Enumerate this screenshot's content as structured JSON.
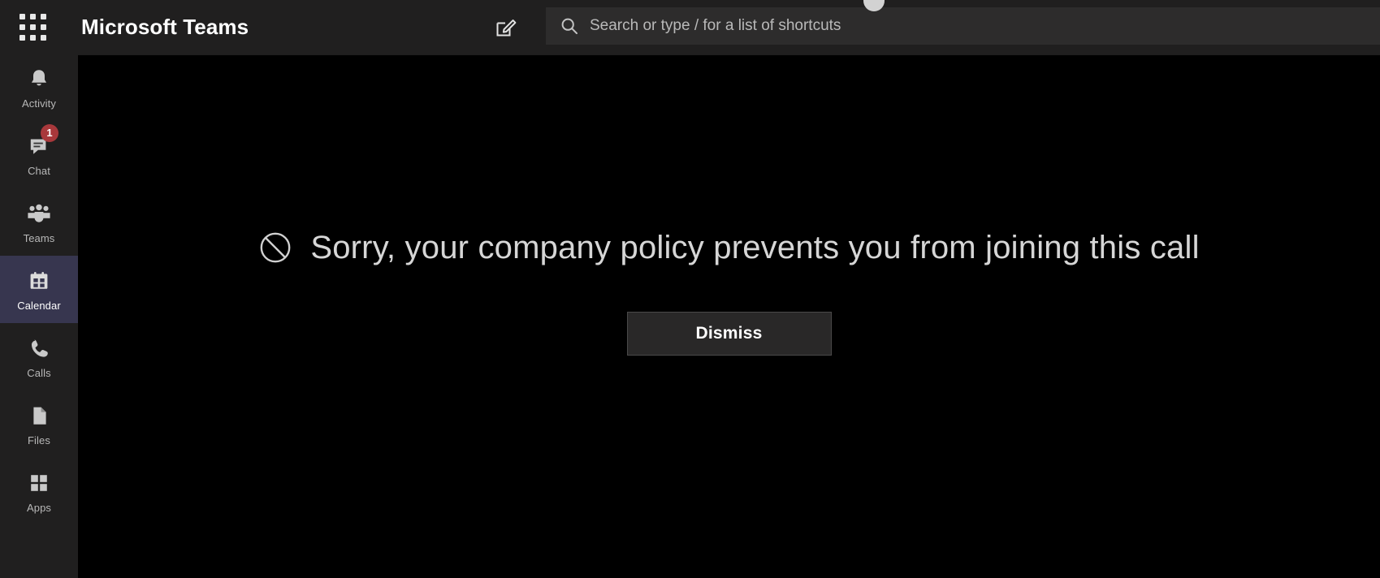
{
  "header": {
    "app_title": "Microsoft Teams",
    "waffle_icon": "grid-menu-icon",
    "compose_icon": "compose-new-icon",
    "search": {
      "icon": "search-icon",
      "value": "",
      "placeholder": "Search or type / for a list of shortcuts"
    }
  },
  "sidebar": {
    "items": [
      {
        "label": "Activity",
        "icon": "bell-icon",
        "selected": false,
        "badge": ""
      },
      {
        "label": "Chat",
        "icon": "chat-bubble-icon",
        "selected": false,
        "badge": "1"
      },
      {
        "label": "Teams",
        "icon": "people-icon",
        "selected": false,
        "badge": ""
      },
      {
        "label": "Calendar",
        "icon": "calendar-icon",
        "selected": true,
        "badge": ""
      },
      {
        "label": "Calls",
        "icon": "phone-icon",
        "selected": false,
        "badge": ""
      },
      {
        "label": "Files",
        "icon": "file-icon",
        "selected": false,
        "badge": ""
      },
      {
        "label": "Apps",
        "icon": "apps-grid-icon",
        "selected": false,
        "badge": ""
      }
    ]
  },
  "main": {
    "status_icon": "blocked-circle-slash-icon",
    "message": "Sorry, your company policy prevents you from joining this call",
    "dismiss_label": "Dismiss"
  },
  "colors": {
    "header_bg": "#201f1f",
    "rail_bg": "#201f1f",
    "stage_bg": "#000000",
    "selected_item_bg": "#37364f",
    "badge_red": "#a8383b",
    "search_bg": "#2d2c2c",
    "button_bg": "#292828",
    "button_border": "#4a4949",
    "message_text": "#d6d6d6"
  }
}
